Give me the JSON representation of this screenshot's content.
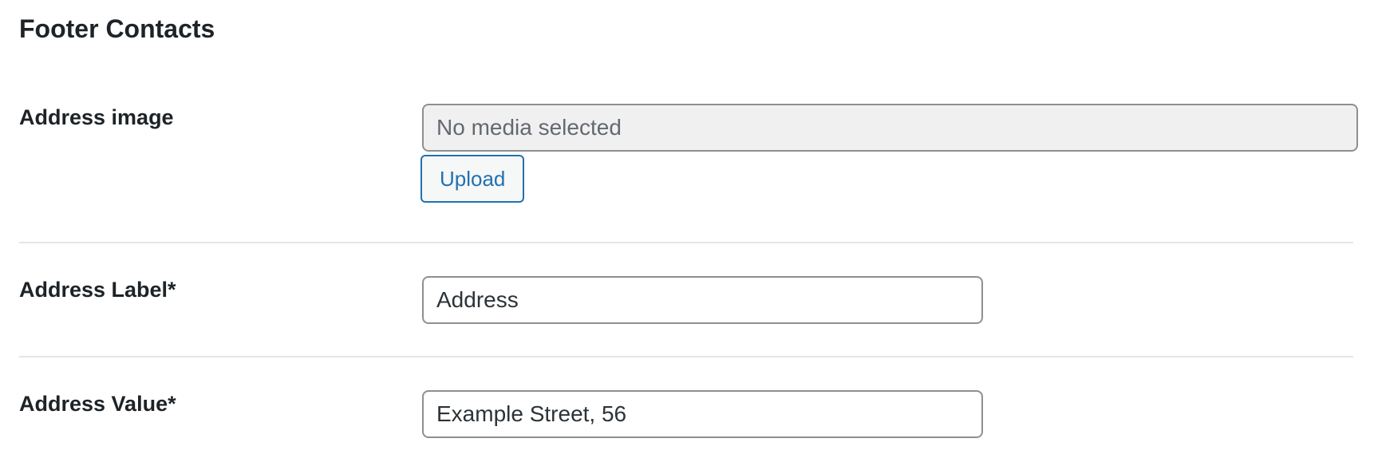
{
  "section": {
    "title": "Footer Contacts"
  },
  "fields": {
    "address_image": {
      "label": "Address image",
      "value": "No media selected",
      "upload_label": "Upload"
    },
    "address_label": {
      "label": "Address Label*",
      "value": "Address"
    },
    "address_value": {
      "label": "Address Value*",
      "value": "Example Street, 56"
    }
  },
  "colors": {
    "accent": "#2271b1",
    "text": "#1d2327",
    "input_border": "#8c8f94",
    "readonly_bg": "#f0f0f1",
    "divider": "#e4e6e9"
  }
}
